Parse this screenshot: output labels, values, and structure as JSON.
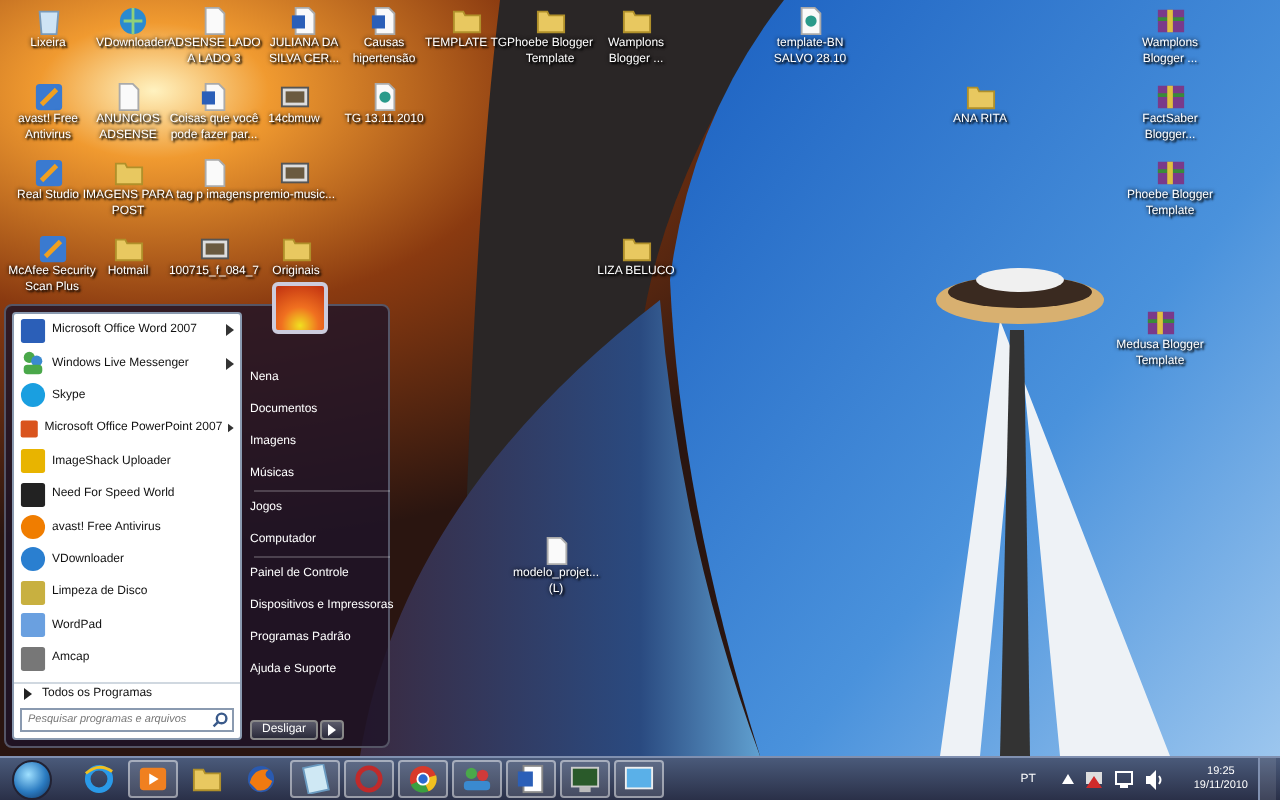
{
  "desktop_icons": [
    {
      "label": "Lixeira",
      "kind": "recycle"
    },
    {
      "label": "VDownloader",
      "kind": "globe"
    },
    {
      "label": "ADSENSE LADO A LADO 3",
      "kind": "document"
    },
    {
      "label": "JULIANA DA SILVA CER...",
      "kind": "word"
    },
    {
      "label": "Causas hipertensão",
      "kind": "word"
    },
    {
      "label": "TEMPLATE TG",
      "kind": "folder"
    },
    {
      "label": "Phoebe Blogger Template",
      "kind": "folder"
    },
    {
      "label": "Wamplons Blogger ...",
      "kind": "folder"
    },
    {
      "label": "template-BN SALVO 28.10",
      "kind": "web"
    },
    {
      "label": "Wamplons Blogger ...",
      "kind": "archive"
    },
    {
      "label": "avast! Free Antivirus",
      "kind": "app"
    },
    {
      "label": "ANUNCIOS ADSENSE",
      "kind": "document"
    },
    {
      "label": "Coisas que você pode fazer par...",
      "kind": "word"
    },
    {
      "label": "14cbmuw",
      "kind": "picture"
    },
    {
      "label": "TG 13.11.2010",
      "kind": "web"
    },
    {
      "label": "ANA RITA",
      "kind": "folder"
    },
    {
      "label": "FactSaber Blogger...",
      "kind": "archive"
    },
    {
      "label": "Real Studio",
      "kind": "app"
    },
    {
      "label": "IMAGENS PARA POST",
      "kind": "folder"
    },
    {
      "label": "tag p imagens",
      "kind": "document"
    },
    {
      "label": "premio-music...",
      "kind": "picture"
    },
    {
      "label": "Phoebe Blogger Template",
      "kind": "archive"
    },
    {
      "label": "McAfee Security Scan Plus",
      "kind": "app"
    },
    {
      "label": "Hotmail",
      "kind": "folder"
    },
    {
      "label": "100715_f_084_7",
      "kind": "picture"
    },
    {
      "label": "Originais",
      "kind": "folder"
    },
    {
      "label": "LIZA BELUCO",
      "kind": "folder"
    },
    {
      "label": "Medusa Blogger Template",
      "kind": "archive"
    },
    {
      "label": "modelo_projet... (L)",
      "kind": "document"
    }
  ],
  "start_menu": {
    "programs": [
      {
        "label": "Microsoft Office Word 2007",
        "kind": "word",
        "submenu": true
      },
      {
        "label": "Windows Live Messenger",
        "kind": "people",
        "submenu": true
      },
      {
        "label": "Skype",
        "kind": "chat",
        "submenu": false
      },
      {
        "label": "Microsoft Office PowerPoint 2007",
        "kind": "slides",
        "submenu": true
      },
      {
        "label": "ImageShack Uploader",
        "kind": "frog",
        "submenu": false
      },
      {
        "label": "Need For Speed World",
        "kind": "game",
        "submenu": false
      },
      {
        "label": "avast! Free Antivirus",
        "kind": "shield",
        "submenu": false
      },
      {
        "label": "VDownloader",
        "kind": "globe",
        "submenu": false
      },
      {
        "label": "Limpeza de Disco",
        "kind": "disk",
        "submenu": false
      },
      {
        "label": "WordPad",
        "kind": "notepad",
        "submenu": false
      },
      {
        "label": "Amcap",
        "kind": "camera",
        "submenu": false
      }
    ],
    "all_programs": "Todos os Programas",
    "search": {
      "placeholder": "Pesquisar programas e arquivos"
    },
    "place_groups": [
      {
        "items": [
          "Nena",
          "Documentos",
          "Imagens",
          "Músicas"
        ]
      },
      {
        "items": [
          "Jogos",
          "Computador"
        ]
      },
      {
        "items": [
          "Painel de Controle",
          "Dispositivos e Impressoras",
          "Programas Padrão",
          "Ajuda e Suporte"
        ]
      }
    ],
    "shutdown": "Desligar"
  },
  "taskbar": {
    "apps": [
      {
        "kind": "browser",
        "running": false
      },
      {
        "kind": "media",
        "running": true
      },
      {
        "kind": "folder",
        "running": false
      },
      {
        "kind": "fox",
        "running": false
      },
      {
        "kind": "notepad",
        "running": true
      },
      {
        "kind": "disc",
        "running": true
      },
      {
        "kind": "chrome",
        "running": true
      },
      {
        "kind": "people",
        "running": true
      },
      {
        "kind": "word",
        "running": true
      },
      {
        "kind": "computer",
        "running": true
      },
      {
        "kind": "screen",
        "running": true
      }
    ],
    "language": "PT",
    "time": "19:25",
    "date": "19/11/2010"
  }
}
